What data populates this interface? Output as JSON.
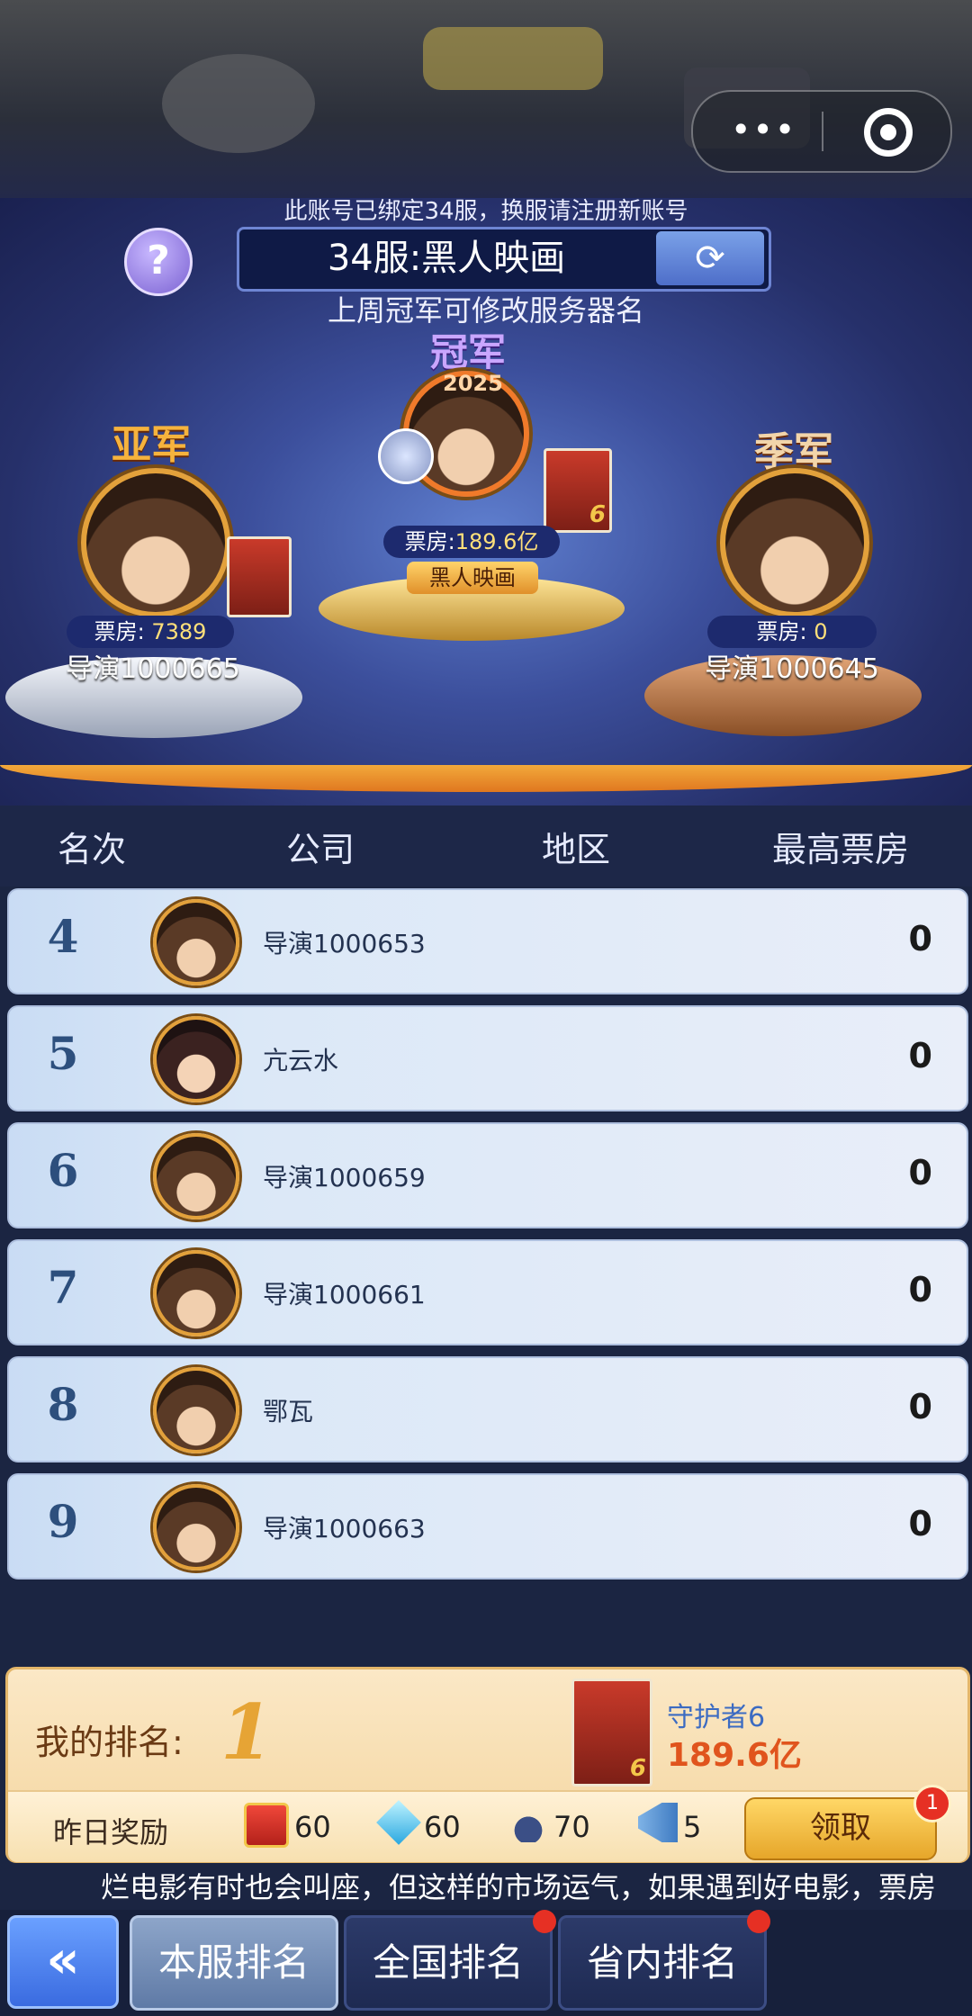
{
  "capsule": {
    "more_icon": "more-dots-icon",
    "close_icon": "target-circle-icon"
  },
  "header": {
    "bind_note": "此账号已绑定34服，换服请注册新账号",
    "server_name": "34服:黑人映画",
    "refresh_icon": "refresh-arrows-icon",
    "help_label": "?",
    "rename_note": "上周冠军可修改服务器名"
  },
  "podium": {
    "champion": {
      "title": "冠军",
      "badge": "2025",
      "box_label": "票房:",
      "box_value": "189.6亿",
      "name": "黑人映画",
      "poster_num": "6"
    },
    "second": {
      "title": "亚军",
      "box_label": "票房:",
      "box_value": "7389",
      "name": "导演1000665"
    },
    "third": {
      "title": "季军",
      "box_label": "票房:",
      "box_value": "0",
      "name": "导演1000645"
    }
  },
  "table": {
    "columns": [
      "名次",
      "公司",
      "地区",
      "最高票房"
    ],
    "rows": [
      {
        "rank": "4",
        "name": "导演1000653",
        "value": "0"
      },
      {
        "rank": "5",
        "name": "亢云水",
        "value": "0"
      },
      {
        "rank": "6",
        "name": "导演1000659",
        "value": "0"
      },
      {
        "rank": "7",
        "name": "导演1000661",
        "value": "0"
      },
      {
        "rank": "8",
        "name": "鄂瓦",
        "value": "0"
      },
      {
        "rank": "9",
        "name": "导演1000663",
        "value": "0"
      }
    ]
  },
  "my_rank": {
    "label": "我的排名:",
    "rank": "1",
    "film": "守护者6",
    "box": "189.6亿",
    "poster_num": "6",
    "reward_label": "昨日奖励",
    "rewards": [
      {
        "icon": "gift-box-icon",
        "value": "60"
      },
      {
        "icon": "diamond-icon",
        "value": "60"
      },
      {
        "icon": "ink-pen-icon",
        "value": "70"
      },
      {
        "icon": "megaphone-icon",
        "value": "5"
      }
    ],
    "claim_label": "领取",
    "claim_badge": "1"
  },
  "ticker": "烂电影有时也会叫座，但这样的市场运气，如果遇到好电影，票房",
  "nav": {
    "back_label": "«",
    "tabs": [
      "本服排名",
      "全国排名",
      "省内排名"
    ]
  },
  "colors": {
    "accent_orange": "#e6a435",
    "badge_red": "#e63024",
    "row_text": "#233250"
  }
}
